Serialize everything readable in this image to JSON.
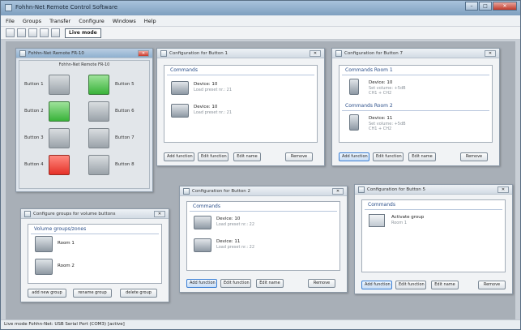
{
  "window": {
    "title": "Fohhn-Net Remote Control Software",
    "controls": [
      "–",
      "□",
      "✕"
    ]
  },
  "menu": [
    "File",
    "Groups",
    "Transfer",
    "Configure",
    "Windows",
    "Help"
  ],
  "toolbar": {
    "live_mode": "Live mode"
  },
  "status": "Live mode  Fohhn-Net: USB Serial Port (COM3) [active]",
  "remote": {
    "title": "Fohhn-Net Remote FR-10",
    "header": "Fohhn-Net Remote FR-10",
    "buttons": [
      {
        "label": "Button 1",
        "state": "off"
      },
      {
        "label": "Button 2",
        "state": "green"
      },
      {
        "label": "Button 3",
        "state": "off"
      },
      {
        "label": "Button 4",
        "state": "red"
      },
      {
        "label": "Button 5",
        "state": "green"
      },
      {
        "label": "Button 6",
        "state": "off"
      },
      {
        "label": "Button 7",
        "state": "off"
      },
      {
        "label": "Button 8",
        "state": "off"
      }
    ]
  },
  "config_windows": [
    {
      "title": "Configuration for Button 1",
      "sections": [
        {
          "header": "Commands",
          "items": [
            {
              "l1": "Device: 10",
              "l2": "Load preset nr.: 21"
            },
            {
              "l1": "Device: 10",
              "l2": "Load preset nr.: 21"
            }
          ]
        }
      ]
    },
    {
      "title": "Configuration for Button 7",
      "sections": [
        {
          "header": "Commands Room 1",
          "items": [
            {
              "l1": "Device: 10",
              "l2": "Set volume: +5dB",
              "l3": "CH1 + CH2"
            }
          ]
        },
        {
          "header": "Commands Room 2",
          "items": [
            {
              "l1": "Device: 11",
              "l2": "Set volume: +5dB",
              "l3": "CH1 + CH2"
            }
          ]
        }
      ]
    },
    {
      "title": "Configuration for Button 2",
      "sections": [
        {
          "header": "Commands",
          "items": [
            {
              "l1": "Device: 10",
              "l2": "Load preset nr.: 22"
            },
            {
              "l1": "Device: 11",
              "l2": "Load preset nr.: 22"
            }
          ]
        }
      ]
    },
    {
      "title": "Configuration for Button 5",
      "sections": [
        {
          "header": "Commands",
          "items": [
            {
              "l1": "Activate group",
              "l2": "Room 1"
            }
          ]
        }
      ]
    }
  ],
  "config_buttons": [
    "Add function",
    "Edit function",
    "Edit name",
    "Remove"
  ],
  "groups": {
    "title": "Configure groups for volume buttons",
    "header": "Volume groups/zones",
    "items": [
      "Room 1",
      "Room 2"
    ],
    "buttons": [
      "add new group",
      "rename group",
      "delete group"
    ]
  }
}
